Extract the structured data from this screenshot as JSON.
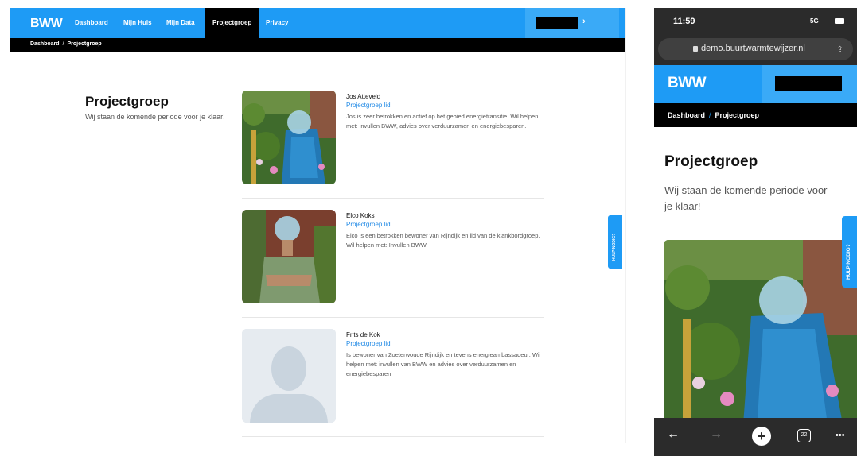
{
  "desktop": {
    "nav": {
      "logo": "BWW",
      "items": [
        {
          "label": "Dashboard"
        },
        {
          "label": "Mijn Huis"
        },
        {
          "label": "Mijn Data"
        },
        {
          "label": "Projectgroep",
          "active": true
        },
        {
          "label": "Privacy"
        }
      ],
      "user_chevron": "›"
    },
    "breadcrumb": {
      "home": "Dashboard",
      "separator": "/",
      "current": "Projectgroep"
    },
    "page": {
      "title": "Projectgroep",
      "subtitle": "Wij staan de komende periode voor je klaar!"
    },
    "members": [
      {
        "name": "Jos Atteveld",
        "role": "Projectgroep lid",
        "description": "Jos is zeer betrokken en actief op het gebied energietransitie. Wil helpen met: invullen BWW, advies over verduurzamen en energiebesparen.",
        "photo": "person-garden-photo"
      },
      {
        "name": "Elco Koks",
        "role": "Projectgroep lid",
        "description": "Elco is een betrokken bewoner van Rijndijk en lid van de klankbordgroep. Wil helpen met: Invullen BWW",
        "photo": "person-brick-wall-photo"
      },
      {
        "name": "Frits de Kok",
        "role": "Projectgroep lid",
        "description": "Is bewoner van Zoeterwoude Rijndijk en tevens energieambassadeur. Wil helpen met: invullen van BWW en advies over verduurzamen en energiebesparen",
        "photo": "placeholder-avatar"
      }
    ],
    "help_tab": "HULP NODIG?",
    "scrollbar_up": "▲"
  },
  "mobile": {
    "status": {
      "time": "11:59",
      "signal": "5G"
    },
    "url": "demo.buurtwarmtewijzer.nl",
    "share_icon": "⇪",
    "logo": "BWW",
    "breadcrumb": {
      "home": "Dashboard",
      "separator": "/",
      "current": "Projectgroep"
    },
    "title": "Projectgroep",
    "subtitle": "Wij staan de komende periode voor je klaar!",
    "help_tab": "HULP NODIG?",
    "toolbar": {
      "back": "←",
      "forward": "→",
      "new_tab": "+",
      "tab_count": "22",
      "menu": "•••"
    }
  },
  "colors": {
    "brand_blue": "#1e9bf5",
    "role_link": "#1e88e5",
    "breadcrumb_bg": "#000000"
  }
}
